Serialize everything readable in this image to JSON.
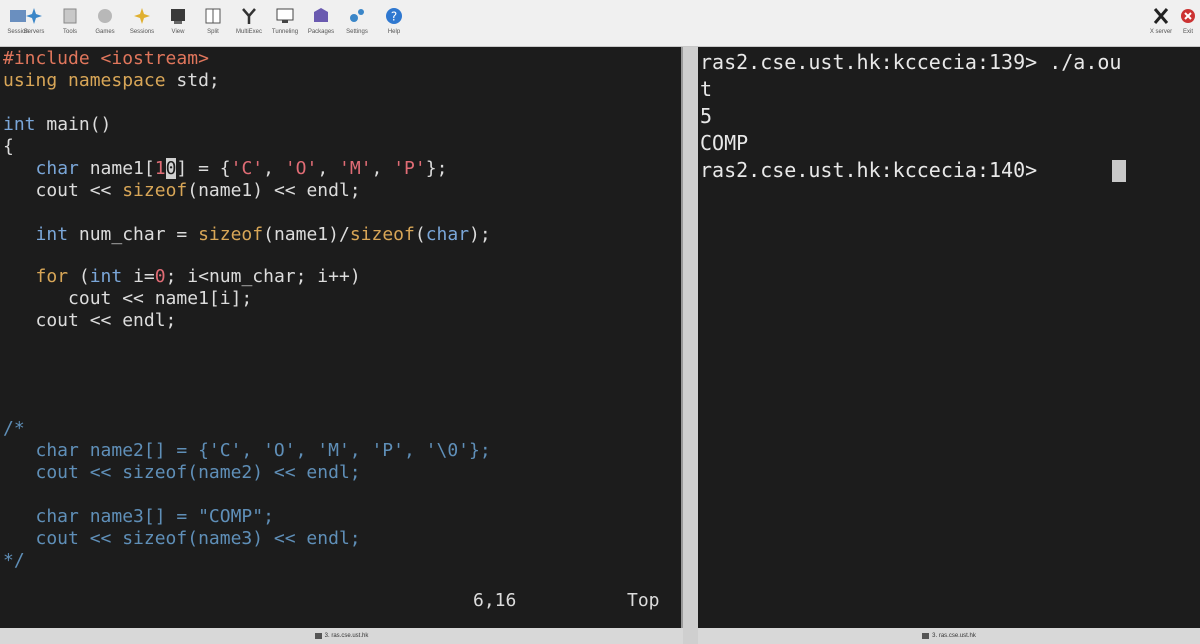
{
  "toolbar": {
    "buttons": [
      {
        "label": "Session",
        "icon": "session-icon"
      },
      {
        "label": "Servers",
        "icon": "servers-icon"
      },
      {
        "label": "Tools",
        "icon": "tools-icon"
      },
      {
        "label": "Games",
        "icon": "games-icon"
      },
      {
        "label": "Sessions",
        "icon": "sessions-icon"
      },
      {
        "label": "View",
        "icon": "view-icon"
      },
      {
        "label": "Split",
        "icon": "split-icon"
      },
      {
        "label": "MultiExec",
        "icon": "multiexec-icon"
      },
      {
        "label": "Tunneling",
        "icon": "tunneling-icon"
      },
      {
        "label": "Packages",
        "icon": "packages-icon"
      },
      {
        "label": "Settings",
        "icon": "settings-icon"
      },
      {
        "label": "Help",
        "icon": "help-icon"
      }
    ],
    "xserver_label": "X server",
    "exit_label": "Exit"
  },
  "editor": {
    "lines": {
      "l1": {
        "a": "#include <iostream>"
      },
      "l2": {
        "a": "using",
        "b": " ",
        "c": "namespace",
        "d": " std;"
      },
      "l4": {
        "a": "int",
        "b": " main()"
      },
      "l5": {
        "a": "{"
      },
      "l6": {
        "a": "   ",
        "b": "char",
        "c": " name1[",
        "d": "1",
        "e": "0",
        "f": "] = {",
        "g": "'C'",
        "h": ", ",
        "i": "'O'",
        "j": ", ",
        "k": "'M'",
        "l": ", ",
        "m": "'P'",
        "n": "};"
      },
      "l7": {
        "a": "   cout << ",
        "b": "sizeof",
        "c": "(name1) << endl;"
      },
      "l9": {
        "a": "   ",
        "b": "int",
        "c": " num_char = ",
        "d": "sizeof",
        "e": "(name1)/",
        "f": "sizeof",
        "g": "(",
        "h": "char",
        "i": ");"
      },
      "l11": {
        "a": "   ",
        "b": "for",
        "c": " (",
        "d": "int",
        "e": " i=",
        "f": "0",
        "g": "; i<num_char; i++)"
      },
      "l12": {
        "a": "      cout << name1[i];"
      },
      "l13": {
        "a": "   cout << endl;"
      },
      "l18": {
        "a": "/*"
      },
      "l19": {
        "a": "   char name2[] = {'C', 'O', 'M', 'P', '\\0'};"
      },
      "l20": {
        "a": "   cout << sizeof(name2) << endl;"
      },
      "l22": {
        "a": "   char name3[] = \"COMP\";"
      },
      "l23": {
        "a": "   cout << sizeof(name3) << endl;"
      },
      "l24": {
        "a": "*/"
      }
    },
    "status_position": "6,16",
    "status_scroll": "Top"
  },
  "terminal": {
    "lines": [
      "ras2.cse.ust.hk:kccecia:139> ./a.ou",
      "t",
      "5",
      "COMP",
      "ras2.cse.ust.hk:kccecia:140> "
    ]
  },
  "tabs": {
    "left": "3. ras.cse.ust.hk",
    "right": "3. ras.cse.ust.hk"
  }
}
